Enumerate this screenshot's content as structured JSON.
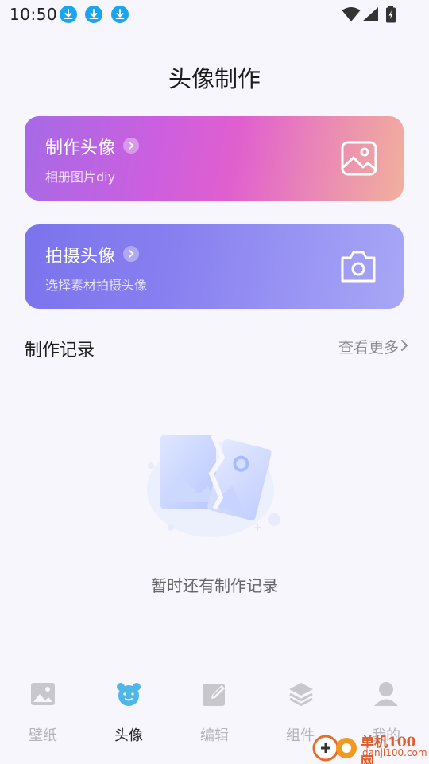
{
  "status_bar": {
    "time": "10:50"
  },
  "page_title": "头像制作",
  "cards": [
    {
      "title": "制作头像",
      "subtitle": "相册图片diy",
      "icon": "image-icon"
    },
    {
      "title": "拍摄头像",
      "subtitle": "选择素材拍摄头像",
      "icon": "camera-icon"
    }
  ],
  "records": {
    "title": "制作记录",
    "more_label": "查看更多",
    "empty_text": "暂时还有制作记录"
  },
  "bottom_nav": [
    {
      "label": "壁纸",
      "icon": "wallpaper-icon",
      "active": false
    },
    {
      "label": "头像",
      "icon": "bear-avatar-icon",
      "active": true
    },
    {
      "label": "编辑",
      "icon": "edit-icon",
      "active": false
    },
    {
      "label": "组件",
      "icon": "layers-icon",
      "active": false
    },
    {
      "label": "我的",
      "icon": "profile-icon",
      "active": false
    }
  ],
  "watermark": {
    "cn": "单机100网",
    "en": "danji100.com"
  },
  "colors": {
    "card1_gradient": [
      "#a66ae6",
      "#e05fcf",
      "#f2b09c"
    ],
    "card2_gradient": [
      "#7b73ec",
      "#a7a7f6"
    ],
    "active_nav_icon": "#4fb6e8",
    "download_badge": "#1aa5f0"
  }
}
